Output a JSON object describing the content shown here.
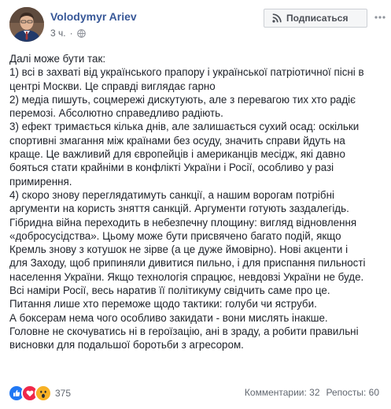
{
  "post": {
    "author_name": "Volodymyr Ariev",
    "timestamp": "3 ч.",
    "separator": "·",
    "privacy_icon": "globe-icon",
    "subscribe_label": "Подписаться",
    "subscribe_icon": "rss-icon",
    "more_icon": "ellipsis-icon",
    "body_lines": [
      "Далі може бути так:",
      "1) всі в захваті від українського прапору і української патріотичної пісні в",
      "центрі Москви. Це справді виглядає гарно",
      "2) медіа пишуть, соцмережі дискутують, але з перевагою тих хто радіє",
      "перемозі. Абсолютно справедливо радіють.",
      "3) ефект тримається кілька днів, але залишається сухий осад: оскільки",
      "спортивні змагання між країнами без осуду, значить справи йдуть на",
      "краще. Це важливий для європейців і американців месідж, які давно",
      "бояться стати крайніми в конфлікті України і Росії, особливо у разі",
      "примирення.",
      "4) скоро знову переглядатимуть санкції, а нашим ворогам потрібні",
      "аргументи на користь зняття санкцій. Аргументи готують заздалегідь.",
      "Гібридна війна переходить в небезпечну площину: вигляд відновлення",
      "«добросусідства». Цьому може бути присвячено багато подій, якщо",
      "Кремль знову з котушок не зірве (а це дуже ймовірно). Нові акценти і",
      "для Заходу, щоб припиняли дивитися пильно, і для приспання пильності",
      "населення України. Якщо технологія спрацює, невдовзі України не буде.",
      "Всі наміри Росії, весь наратив її політикуму свідчить саме про це.",
      "Питання лише хто переможе щодо тактики: голуби чи яструби.",
      "А боксерам нема чого особливо закидати - вони мислять інакше.",
      "Головне не скочуватись ні в героїзацію, ані в зраду, а робити правильні",
      "висновки для подальшої боротьби з агресором."
    ],
    "reactions": {
      "icons": [
        "like-icon",
        "love-icon",
        "wow-icon"
      ],
      "count": "375"
    },
    "comments_label": "Комментарии: 32",
    "shares_label": "Репосты: 60",
    "colors": {
      "author": "#385898",
      "text": "#1d2129",
      "meta": "#616770",
      "like": "#2078f4",
      "love": "#f0284a",
      "wow": "#f7b125"
    }
  }
}
